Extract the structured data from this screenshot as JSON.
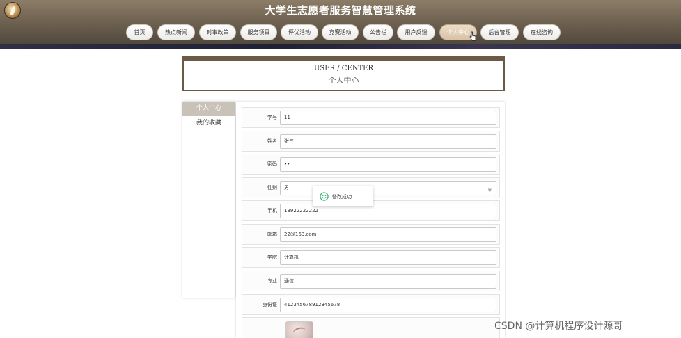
{
  "site_title": "大学生志愿者服务智慧管理系统",
  "nav": [
    {
      "label": "首页"
    },
    {
      "label": "热点新闻"
    },
    {
      "label": "时事政策"
    },
    {
      "label": "服务项目"
    },
    {
      "label": "评优活动"
    },
    {
      "label": "竞赛活动"
    },
    {
      "label": "公告栏"
    },
    {
      "label": "用户反馈"
    },
    {
      "label": "个人中心",
      "active": true
    },
    {
      "label": "后台管理"
    },
    {
      "label": "在线咨询"
    }
  ],
  "page_heading": {
    "en": "USER / CENTER",
    "cn": "个人中心"
  },
  "left_menu": [
    {
      "label": "个人中心",
      "active": true
    },
    {
      "label": "我的收藏"
    }
  ],
  "form": {
    "student_id": {
      "label": "学号",
      "value": "11"
    },
    "name": {
      "label": "姓名",
      "value": "张三"
    },
    "password": {
      "label": "密码",
      "value": "••"
    },
    "gender": {
      "label": "性别",
      "value": "男"
    },
    "phone": {
      "label": "手机",
      "value": "13922222222"
    },
    "email": {
      "label": "邮箱",
      "value": "22@163.com"
    },
    "college": {
      "label": "学院",
      "value": "计算机"
    },
    "major": {
      "label": "专业",
      "value": "通信"
    },
    "id_card": {
      "label": "身份证",
      "value": "412345678912345678"
    }
  },
  "toast": {
    "text": "修改成功"
  },
  "watermark": "CSDN @计算机程序设计源哥",
  "colors": {
    "header": "#6e6150",
    "accent": "#6b5a45",
    "active_menu": "#c8c2b9",
    "success": "#2fb36b"
  }
}
